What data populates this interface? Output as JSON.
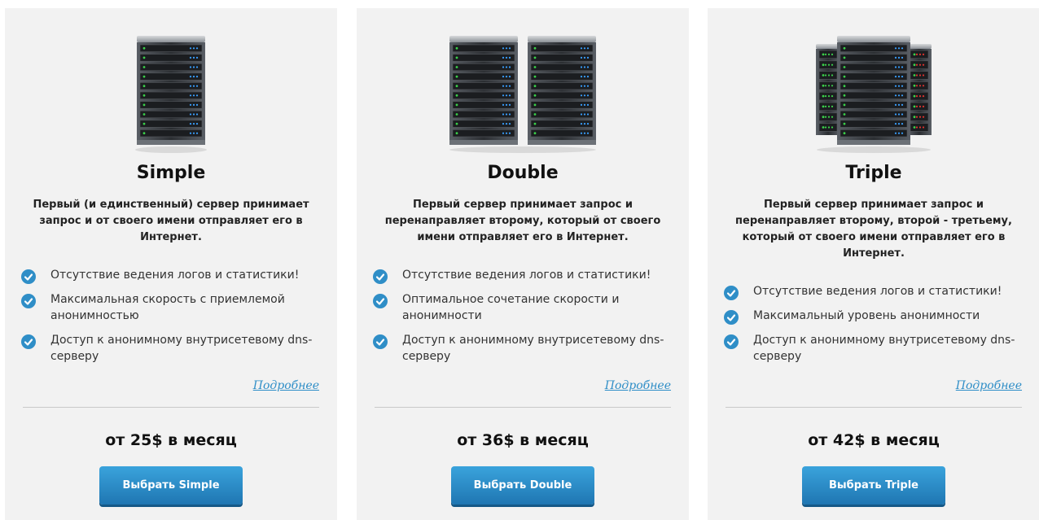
{
  "plans": [
    {
      "title": "Simple",
      "description": "Первый (и единственный) сервер принимает запрос и от своего имени отправляет его в Интернет.",
      "features": [
        "Отсутствие ведения логов и статистики!",
        "Максимальная скорость с приемлемой анонимностью",
        "Доступ к анонимному внутрисетевому dns-серверу"
      ],
      "more_link": "Подробнее",
      "price": "от 25$ в месяц",
      "button": "Выбрать Simple",
      "icon": "single-server-rack-icon"
    },
    {
      "title": "Double",
      "description": "Первый сервер принимает запрос и перенаправляет второму, который от своего имени отправляет его в Интернет.",
      "features": [
        "Отсутствие ведения логов и статистики!",
        "Оптимальное сочетание скорости и анонимности",
        "Доступ к анонимному внутрисетевому dns-серверу"
      ],
      "more_link": "Подробнее",
      "price": "от 36$ в месяц",
      "button": "Выбрать Double",
      "icon": "double-server-rack-icon"
    },
    {
      "title": "Triple",
      "description": "Первый сервер принимает запрос и перенаправляет второму, второй - третьему, который от своего имени отправляет его в Интернет.",
      "features": [
        "Отсутствие ведения логов и статистики!",
        "Максимальный уровень анонимности",
        "Доступ к анонимному внутрисетевому dns-серверу"
      ],
      "more_link": "Подробнее",
      "price": "от 42$ в месяц",
      "button": "Выбрать Triple",
      "icon": "triple-server-rack-icon"
    }
  ],
  "colors": {
    "accent": "#2f8ec7",
    "button_top": "#3aa3dc",
    "button_bottom": "#1f76b2",
    "card_bg": "#f2f2f2"
  }
}
